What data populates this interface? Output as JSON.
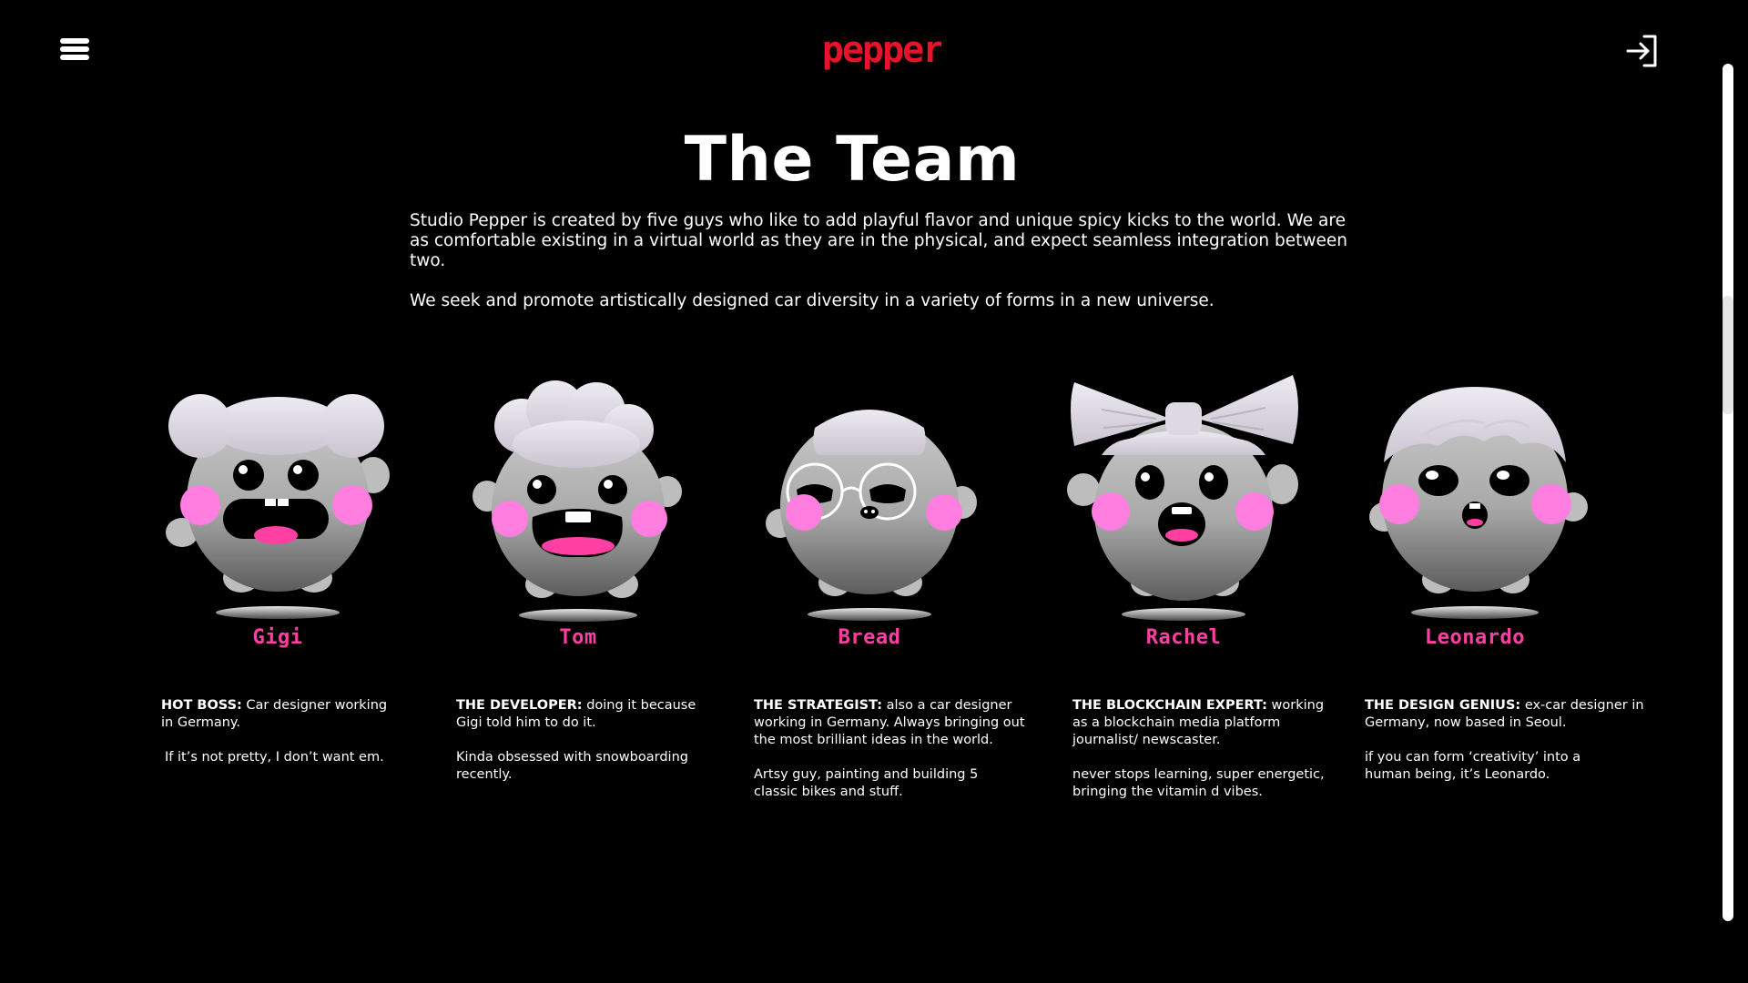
{
  "header": {
    "logo_text": "pepper",
    "brand_color": "#e6132a"
  },
  "page": {
    "title": "The Team",
    "intro_p1": "Studio Pepper is created by five guys who like to add playful flavor and unique spicy kicks to the world. We are as comfortable existing in a virtual world as they are in the physical, and expect seamless integration between two.",
    "intro_p2": "We seek and promote artistically designed car diversity in a variety of forms in a new universe."
  },
  "accent_color": "#ff3fa2",
  "members": [
    {
      "name": "Gigi",
      "role": "HOT BOSS:",
      "desc": "Car designer working in Germany.",
      "extra": "If it’s not pretty, I don’t want em."
    },
    {
      "name": "Tom",
      "role": "THE DEVELOPER:",
      "desc": "doing it because Gigi told him to do it.",
      "extra": "Kinda obsessed with snowboarding recently."
    },
    {
      "name": "Bread",
      "role": "THE STRATEGIST:",
      "desc": "also a car designer working in Germany. Always bringing out the most brilliant ideas in the world.",
      "extra": "Artsy guy, painting and building 5 classic bikes and stuff."
    },
    {
      "name": "Rachel",
      "role": "THE BLOCKCHAIN EXPERT:",
      "desc": "working as a blockchain media platform journalist/ newscaster.",
      "extra": "never stops learning, super energetic, bringing the vitamin d vibes."
    },
    {
      "name": "Leonardo",
      "role": "THE DESIGN GENIUS:",
      "desc": "ex-car designer in Germany, now based in Seoul.",
      "extra": "if you can form ‘creativity’ into a human being, it’s Leonardo."
    }
  ]
}
